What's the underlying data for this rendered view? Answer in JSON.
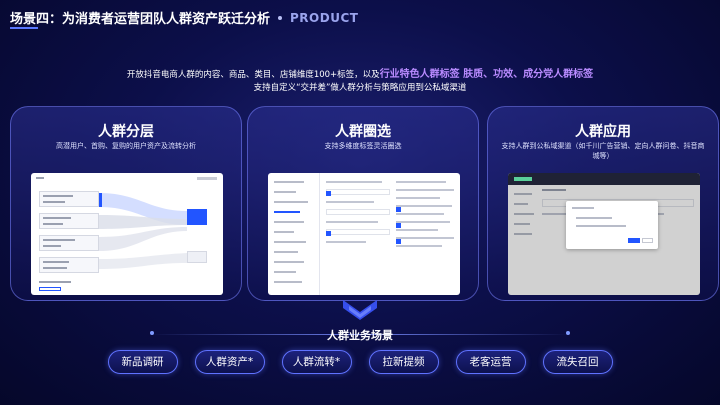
{
  "header": {
    "title": "场景四：为消费者运营团队人群资产跃迁分析",
    "product": "PRODUCT"
  },
  "intro": {
    "line1_prefix": "开放抖音电商人群的内容、商品、类目、店铺维度100+标签，以及",
    "line1_highlight": "行业特色人群标签 肤质、功效、成分党人群标签",
    "line2": "支持自定义“交并差”做人群分析与策略应用到公私域渠道"
  },
  "cards": [
    {
      "title": "人群分层",
      "desc": "高潜用户、首购、复购的用户资产及流转分析"
    },
    {
      "title": "人群圈选",
      "desc": "支持多维度标签灵活圈选"
    },
    {
      "title": "人群应用",
      "desc": "支持人群到公私域渠道（如千川广告营销、定向人群问卷、抖音商城等）"
    }
  ],
  "business": {
    "title": "人群业务场景",
    "tags": [
      "新品调研",
      "人群资产*",
      "人群流转*",
      "拉新提频",
      "老客运营",
      "流失召回"
    ]
  },
  "colors": {
    "accent": "#5a78ff",
    "highlight": "#b98bff",
    "node_blue": "#2255ff"
  }
}
